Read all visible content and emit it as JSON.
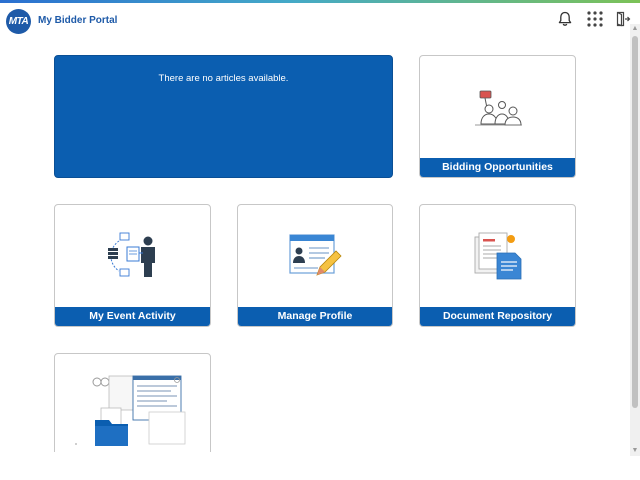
{
  "header": {
    "logo_text": "MTA",
    "title": "My Bidder Portal",
    "icons": [
      "bell-icon",
      "app-grid-icon",
      "sign-out-icon"
    ]
  },
  "news": {
    "message": "There are no articles available."
  },
  "tiles": [
    {
      "label": "Bidding Opportunities",
      "icon": "bidding-illustration"
    },
    {
      "label": "My Event Activity",
      "icon": "event-activity-illustration"
    },
    {
      "label": "Manage Profile",
      "icon": "profile-illustration"
    },
    {
      "label": "Document Repository",
      "icon": "documents-illustration"
    },
    {
      "label": "",
      "icon": "forms-folder-illustration"
    }
  ],
  "colors": {
    "brand_blue": "#0b5eb0",
    "title_blue": "#1e5aa8",
    "tile_border": "#c7c7c7"
  }
}
